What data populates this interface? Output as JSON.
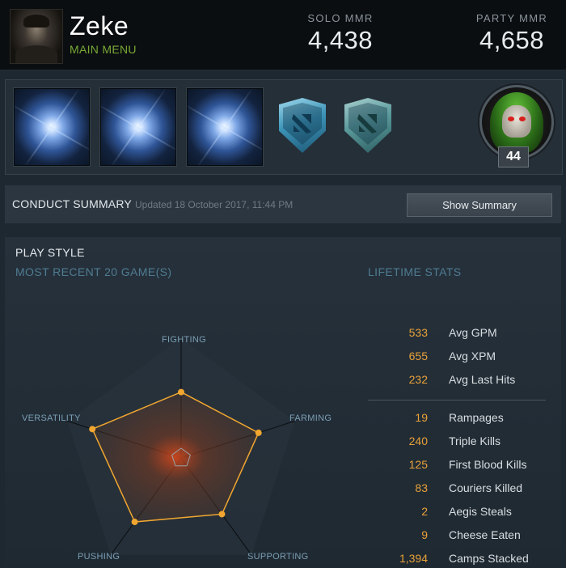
{
  "profile": {
    "name": "Zeke",
    "menu_link": "MAIN MENU",
    "solo_mmr_label": "SOLO MMR",
    "solo_mmr_value": "4,438",
    "party_mmr_label": "PARTY MMR",
    "party_mmr_value": "4,658"
  },
  "badges": {
    "medal_tiles": [
      "glowing-orb-icon",
      "glowing-orb-icon",
      "glowing-orb-icon"
    ],
    "shields": [
      "dota-shield-blue-icon",
      "dota-shield-teal-icon"
    ],
    "level": "44"
  },
  "conduct": {
    "title": "CONDUCT SUMMARY",
    "updated": "Updated 18 October 2017, 11:44 PM",
    "button": "Show Summary"
  },
  "playstyle": {
    "title": "PLAY STYLE",
    "recent_label": "MOST RECENT 20 GAME(S)",
    "lifetime_label": "LIFETIME STATS",
    "axes": [
      "FIGHTING",
      "FARMING",
      "SUPPORTING",
      "PUSHING",
      "VERSATILITY"
    ],
    "values": [
      0.55,
      0.68,
      0.58,
      0.66,
      0.78
    ]
  },
  "lifetime_stats": {
    "averages": [
      {
        "value": "533",
        "label": "Avg GPM"
      },
      {
        "value": "655",
        "label": "Avg XPM"
      },
      {
        "value": "232",
        "label": "Avg Last Hits"
      }
    ],
    "totals": [
      {
        "value": "19",
        "label": "Rampages"
      },
      {
        "value": "240",
        "label": "Triple Kills"
      },
      {
        "value": "125",
        "label": "First Blood Kills"
      },
      {
        "value": "83",
        "label": "Couriers Killed"
      },
      {
        "value": "2",
        "label": "Aegis Steals"
      },
      {
        "value": "9",
        "label": "Cheese Eaten"
      },
      {
        "value": "1,394",
        "label": "Camps Stacked"
      }
    ]
  },
  "colors": {
    "accent_green": "#78a935",
    "stat_orange": "#e8a13a",
    "radar_orange": "#f0a630",
    "section_blue": "#4f7c93"
  }
}
